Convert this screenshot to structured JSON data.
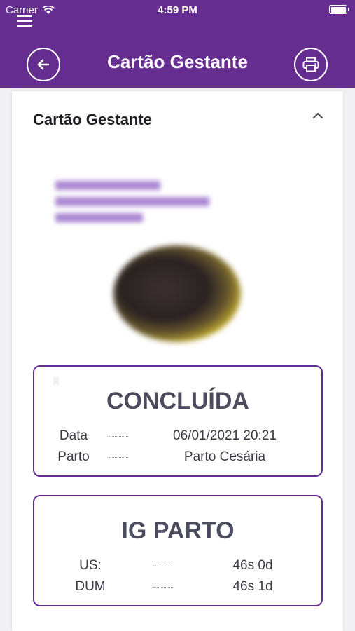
{
  "status_bar": {
    "carrier": "Carrier",
    "time": "4:59 PM"
  },
  "header": {
    "title": "Cartão Gestante"
  },
  "card": {
    "title": "Cartão Gestante",
    "blurred_text_present": true
  },
  "concluida": {
    "title": "CONCLUÍDA",
    "rows": [
      {
        "label": "Data",
        "value": "06/01/2021 20:21"
      },
      {
        "label": "Parto",
        "value": "Parto Cesária"
      }
    ]
  },
  "ig_parto": {
    "title": "IG PARTO",
    "rows": [
      {
        "label": "US:",
        "value": "46s 0d"
      },
      {
        "label": "DUM",
        "value": "46s 1d"
      }
    ]
  },
  "colors": {
    "brand_purple": "#662d91",
    "text_dark": "#4b4d5e"
  },
  "icons": [
    "menu-icon",
    "back-arrow-icon",
    "printer-icon",
    "chevron-up-icon",
    "wifi-icon",
    "battery-icon"
  ]
}
